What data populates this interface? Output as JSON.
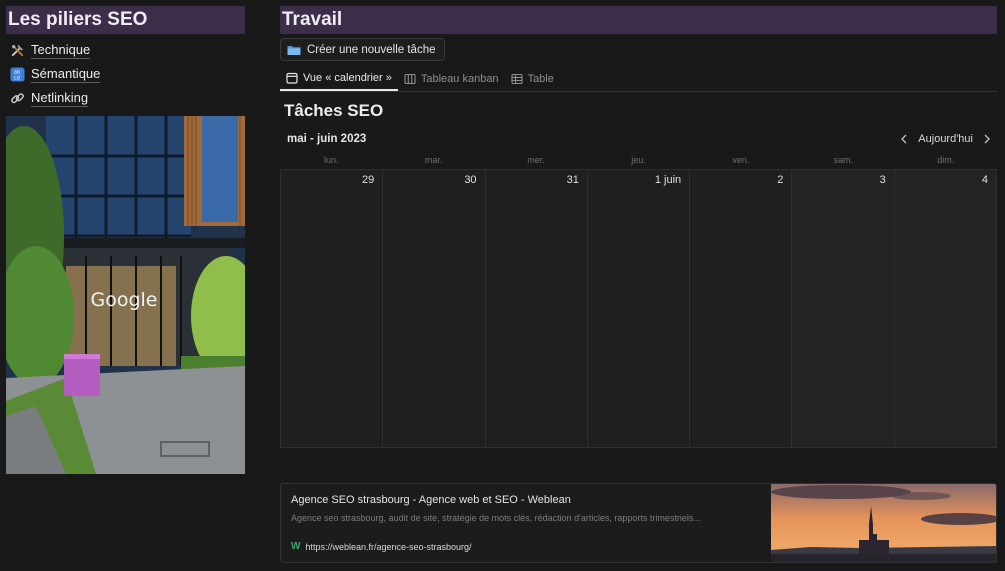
{
  "left": {
    "title": "Les piliers SEO",
    "items": [
      {
        "label": "Technique",
        "icon": "tools-icon"
      },
      {
        "label": "Sémantique",
        "icon": "abcd-icon"
      },
      {
        "label": "Netlinking",
        "icon": "link-icon"
      }
    ],
    "photo": {
      "sign_text": "Google"
    }
  },
  "right": {
    "title": "Travail",
    "new_task_label": "Créer une nouvelle tâche",
    "tabs": [
      {
        "label": "Vue « calendrier »",
        "icon": "calendar-icon",
        "active": true
      },
      {
        "label": "Tableau kanban",
        "icon": "board-icon",
        "active": false
      },
      {
        "label": "Table",
        "icon": "table-icon",
        "active": false
      }
    ],
    "database_title": "Tâches SEO",
    "calendar": {
      "month_label": "mai - juin 2023",
      "today_label": "Aujourd'hui",
      "weekdays": [
        "lun.",
        "mar.",
        "mer.",
        "jeu.",
        "ven.",
        "sam.",
        "dim."
      ],
      "days": [
        "29",
        "30",
        "31",
        "1 juin",
        "2",
        "3",
        "4"
      ]
    }
  },
  "bookmark": {
    "title": "Agence SEO strasbourg - Agence web et SEO - Weblean",
    "description": "Agence seo strasbourg, audit de site, stratégie de mots clés, rédaction d'articles, rapports trimestriels...",
    "url": "https://weblean.fr/agence-seo-strasbourg/",
    "favicon_letter": "W"
  },
  "colors": {
    "background": "#191919",
    "heading_bar": "#3c2d49",
    "favicon": "#3fa36a"
  }
}
